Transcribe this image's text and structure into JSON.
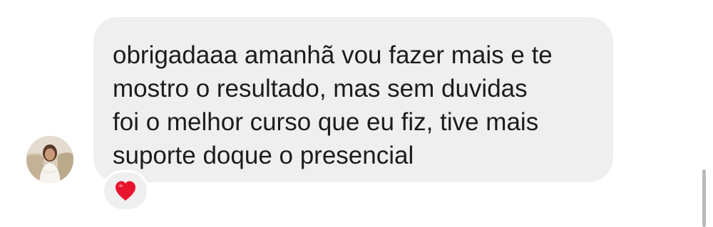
{
  "message": {
    "lines": [
      "obrigadaaa amanhã vou fazer mais e te",
      "mostro o resultado, mas sem duvidas",
      "foi o melhor curso que eu fiz, tive mais",
      "suporte doque o presencial"
    ]
  },
  "reaction": {
    "icon": "heart-icon",
    "color": "#e8142e"
  },
  "colors": {
    "bubble": "#efefef",
    "text": "#1c1c1c",
    "background": "#ffffff"
  }
}
